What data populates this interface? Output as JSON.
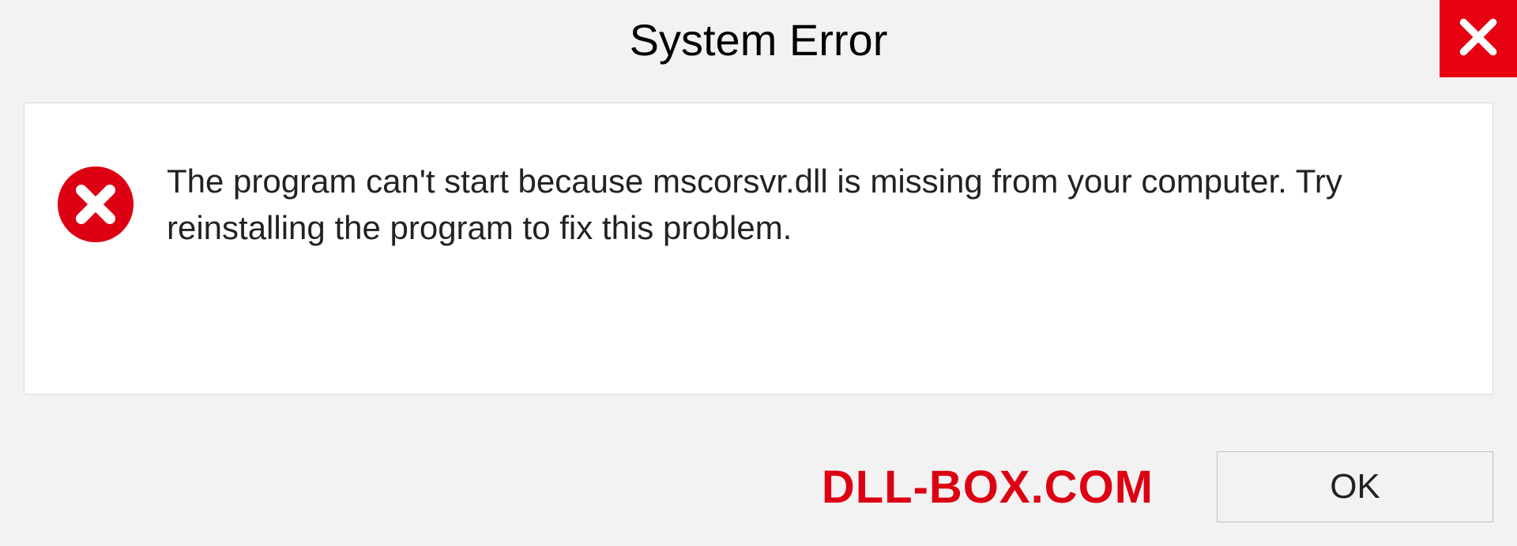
{
  "titlebar": {
    "title": "System Error"
  },
  "dialog": {
    "message": "The program can't start because mscorsvr.dll is missing from your computer. Try reinstalling the program to fix this problem."
  },
  "footer": {
    "watermark": "DLL-BOX.COM",
    "ok_label": "OK"
  },
  "colors": {
    "accent_red": "#e60012",
    "error_red": "#dc0012"
  }
}
